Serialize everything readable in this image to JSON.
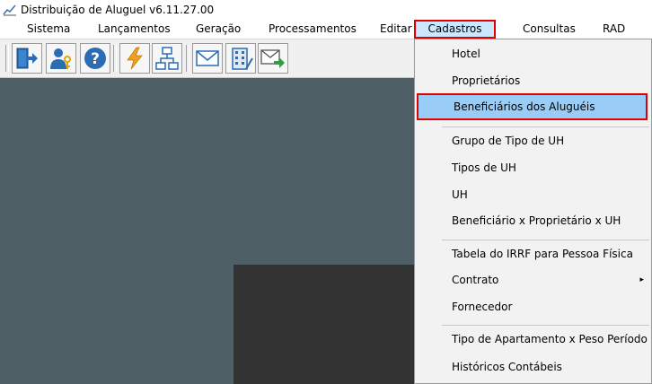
{
  "window": {
    "title": "Distribuição de Aluguel v6.11.27.00",
    "icon": "chart-line-icon"
  },
  "menubar": {
    "items": [
      {
        "label": "Sistema"
      },
      {
        "label": "Lançamentos"
      },
      {
        "label": "Geração"
      },
      {
        "label": "Processamentos"
      },
      {
        "label": "Editar"
      },
      {
        "label": "Cadastros"
      },
      {
        "label": "Consultas"
      },
      {
        "label": "RAD"
      }
    ],
    "active_index": 5
  },
  "toolbar": {
    "buttons": [
      {
        "icon": "exit-door-icon"
      },
      {
        "icon": "user-key-icon"
      },
      {
        "icon": "help-icon"
      },
      {
        "icon": "lightning-icon"
      },
      {
        "icon": "org-chart-icon"
      },
      {
        "icon": "envelope-icon"
      },
      {
        "icon": "building-icon"
      },
      {
        "icon": "mail-send-icon"
      }
    ]
  },
  "dropdown": {
    "items": [
      {
        "label": "Hotel"
      },
      {
        "label": "Proprietários"
      },
      {
        "label": "Beneficiários dos Aluguéis",
        "highlighted": true
      },
      {
        "label": "Grupo de Tipo de UH"
      },
      {
        "label": "Tipos de UH"
      },
      {
        "label": "UH"
      },
      {
        "label": "Beneficiário x Proprietário x UH"
      },
      {
        "label": "Tabela do IRRF para Pessoa Física"
      },
      {
        "label": "Contrato",
        "submenu_arrow": "▸"
      },
      {
        "label": "Fornecedor"
      },
      {
        "label": "Tipo de Apartamento x Peso Período"
      },
      {
        "label": "Históricos Contábeis"
      }
    ]
  },
  "colors": {
    "workspace": "#4f5f66",
    "highlight": "#99cdf7",
    "annotation_border": "#e00000"
  }
}
